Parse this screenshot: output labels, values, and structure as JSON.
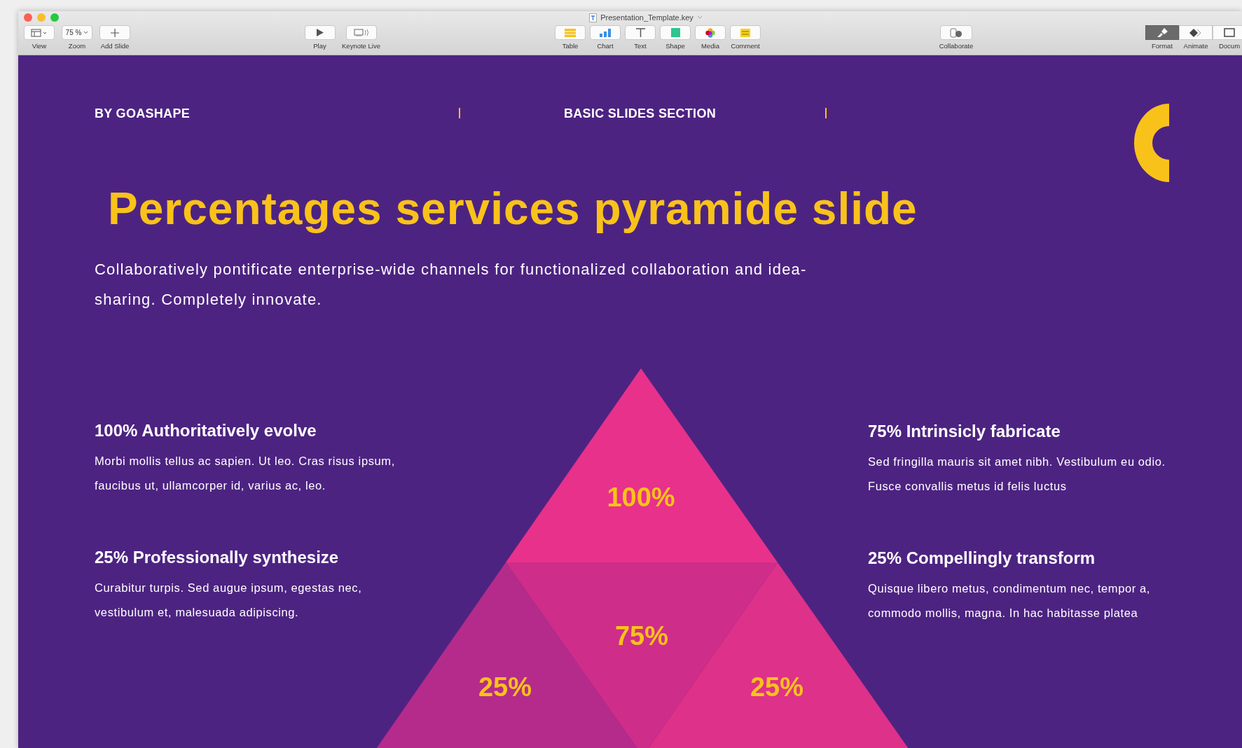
{
  "window": {
    "title": "Presentation_Template.key",
    "toolbar": [
      {
        "items": [
          {
            "kind": "view",
            "label": "View"
          },
          {
            "kind": "zoom",
            "label": "Zoom",
            "value": "75 %"
          },
          {
            "kind": "add",
            "label": "Add Slide"
          }
        ]
      },
      {
        "items": [
          {
            "kind": "play",
            "label": "Play"
          },
          {
            "kind": "live",
            "label": "Keynote Live"
          }
        ]
      },
      {
        "items": [
          {
            "kind": "table",
            "label": "Table"
          },
          {
            "kind": "chart",
            "label": "Chart"
          },
          {
            "kind": "text",
            "label": "Text"
          },
          {
            "kind": "shape",
            "label": "Shape"
          },
          {
            "kind": "media",
            "label": "Media"
          },
          {
            "kind": "comment",
            "label": "Comment"
          }
        ]
      },
      {
        "items": [
          {
            "kind": "collaborate",
            "label": "Collaborate"
          }
        ]
      },
      {
        "items": [
          {
            "kind": "format",
            "label": "Format",
            "selected": true
          },
          {
            "kind": "animate",
            "label": "Animate",
            "selected": false
          },
          {
            "kind": "document",
            "label": "Docum",
            "selected": false
          }
        ]
      }
    ]
  },
  "slide": {
    "header_left": "BY GOASHAPE",
    "header_center": "BASIC SLIDES SECTION",
    "title": "Percentages services pyramide slide",
    "subtitle": "Collaboratively pontificate enterprise-wide channels for functionalized collaboration and idea-sharing. Completely innovate.",
    "features": [
      {
        "heading": "100% Authoritatively evolve",
        "body": "Morbi mollis tellus ac sapien. Ut leo. Cras risus ipsum, faucibus ut, ullamcorper id, varius ac, leo."
      },
      {
        "heading": "25% Professionally synthesize",
        "body": "Curabitur turpis. Sed augue ipsum, egestas nec, vestibulum et, malesuada adipiscing."
      },
      {
        "heading": "75% Intrinsicly fabricate",
        "body": "Sed fringilla mauris sit amet nibh. Vestibulum eu odio. Fusce convallis metus id felis luctus"
      },
      {
        "heading": "25% Compellingly transform",
        "body": "Quisque libero metus, condimentum nec, tempor a, commodo mollis, magna. In hac habitasse platea"
      }
    ],
    "pyramid_labels": [
      "100%",
      "75%",
      "25%",
      "25%"
    ]
  }
}
